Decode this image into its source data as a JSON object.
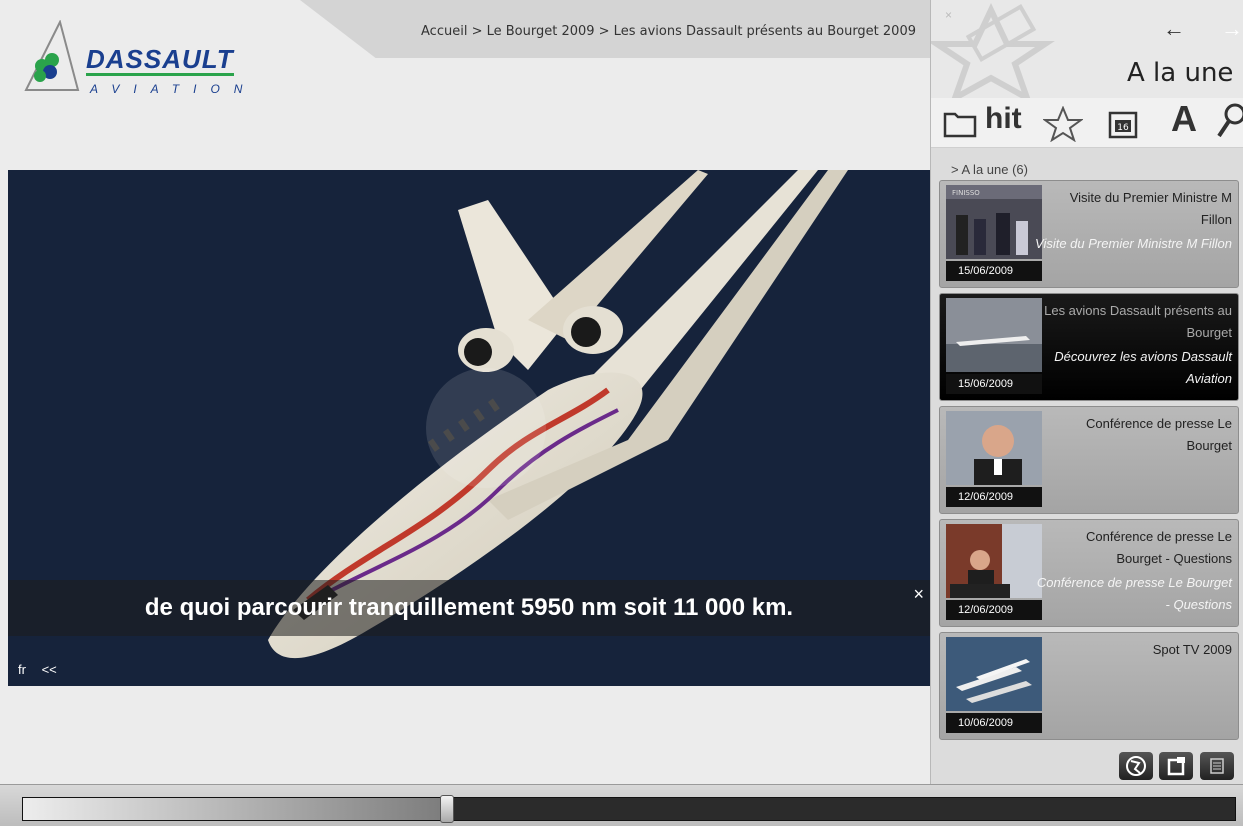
{
  "header": {
    "breadcrumb": "Accueil > Le Bourget 2009 > Les avions Dassault présents au Bourget 2009",
    "logo_name": "DASSAULT",
    "logo_sub": "AVIATION"
  },
  "video": {
    "subtitle": "de quoi parcourir tranquillement  5950 nm soit 11 000 km.",
    "subtitle_close": "×",
    "lang": "fr",
    "rewind": "<<"
  },
  "timeline": {
    "progress": 0.35
  },
  "sidebar": {
    "close": "×",
    "back": "←",
    "forward": "→",
    "title": "A la une",
    "hit_label": "hit",
    "a_label": "A",
    "calendar_day": "16",
    "section": "> A la une (6)",
    "items": [
      {
        "date": "15/06/2009",
        "title": "Visite du Premier Ministre M Fillon",
        "desc": "Visite du Premier Ministre M Fillon",
        "thumb_text": "FINISSO",
        "active": false
      },
      {
        "date": "15/06/2009",
        "title": "Les avions Dassault présents au Bourget",
        "desc": "Découvrez les avions Dassault Aviation",
        "thumb_text": "",
        "active": true
      },
      {
        "date": "12/06/2009",
        "title": "Conférence de presse Le Bourget",
        "desc": "",
        "thumb_text": "",
        "active": false
      },
      {
        "date": "12/06/2009",
        "title": "Conférence de presse Le Bourget - Questions",
        "desc": "Conférence de presse Le Bourget - Questions",
        "thumb_text": "",
        "active": false
      },
      {
        "date": "10/06/2009",
        "title": "Spot TV 2009",
        "desc": "",
        "thumb_text": "",
        "active": false
      }
    ]
  },
  "icons": [
    "folder-icon",
    "star-film-icon",
    "calendar-icon",
    "search-icon",
    "globe-icon",
    "popout-icon",
    "list-icon"
  ],
  "colors": {
    "brand_blue": "#1a3f8f",
    "brand_green": "#2aa34b"
  }
}
